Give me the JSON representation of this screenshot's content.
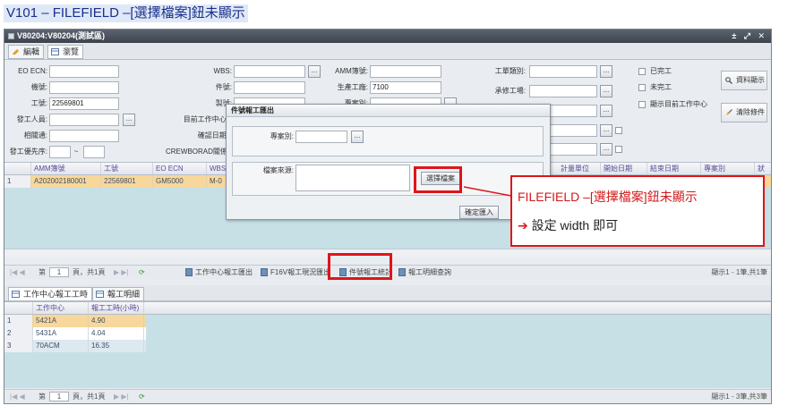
{
  "doc_title": "V101 – FILEFIELD –[選擇檔案]鈕未顯示",
  "window": {
    "title": "V80204:V80204(測試區)",
    "controls": "± ⤢ ✕",
    "tabs": [
      "編輯",
      "瀏覽"
    ]
  },
  "form": {
    "labels": {
      "eo_ecn": "EO ECN:",
      "model": "機號:",
      "work_no": "工號:",
      "issuer": "發工人員:",
      "rel_route": "相關通:",
      "issue_priority": "發工優先序:",
      "wbs": "WBS:",
      "part_no": "件號:",
      "make_no": "製號:",
      "current_wc": "目前工作中心:",
      "conf_date": "確認日期:",
      "crew_board": "CREWBORAD關係:",
      "amm_ledger": "AMM簿號:",
      "prod_wc": "生產工廠:",
      "case_no": "專案別:",
      "work_class": "工單類別:",
      "accept_plant": "承修工場:"
    },
    "values": {
      "work_no": "22569801",
      "prod_wc": "7100",
      "priority_sep": "~"
    },
    "checkboxes": [
      "已完工",
      "未完工",
      "顯示目前工作中心"
    ],
    "side_buttons": [
      "資料顯示",
      "清除條件"
    ]
  },
  "grid1": {
    "headers": [
      "AMM簿號",
      "工號",
      "EO ECN",
      "WBS",
      "計量單位",
      "開始日期",
      "結束日期",
      "專案別",
      "狀"
    ],
    "rows": [
      {
        "idx": "1",
        "amm": "A202002180001",
        "work_no": "22569801",
        "eo": "GM5000",
        "wbs": "M-0"
      }
    ],
    "pager": {
      "page_label": "第",
      "page_value": "1",
      "page_total": "頁，共1頁",
      "buttons": [
        "工作中心報工匯出",
        "F16V報工現況匯出",
        "件號報工統計",
        "報工明細查詢"
      ],
      "display": "顯示1 - 1筆,共1筆"
    }
  },
  "grid2": {
    "tabs": [
      "工作中心報工工時",
      "報工明細"
    ],
    "headers": [
      "工作中心",
      "報工工時(小時)"
    ],
    "rows": [
      {
        "idx": "1",
        "wc": "5421A",
        "hrs": "4.90"
      },
      {
        "idx": "2",
        "wc": "5431A",
        "hrs": "4.04"
      },
      {
        "idx": "3",
        "wc": "70ACM",
        "hrs": "16.35"
      }
    ],
    "pager": {
      "page_label": "第",
      "page_value": "1",
      "page_total": "頁，共1頁",
      "display": "顯示1 - 3筆,共3筆"
    }
  },
  "popup": {
    "title": "件號報工匯出",
    "case_label": "專案別:",
    "file_label": "檔案來源:",
    "select_file": "選擇檔案",
    "confirm": "確定匯入",
    "ellipsis": "..."
  },
  "callout": {
    "line1": "FILEFIELD –[選擇檔案]鈕未顯示",
    "arrow": "➔",
    "line2": "設定  width  即可"
  },
  "colors": {
    "annotation": "#e0141a",
    "grid_body": "#c6e0e6",
    "selected_row": "#f7d79b"
  }
}
